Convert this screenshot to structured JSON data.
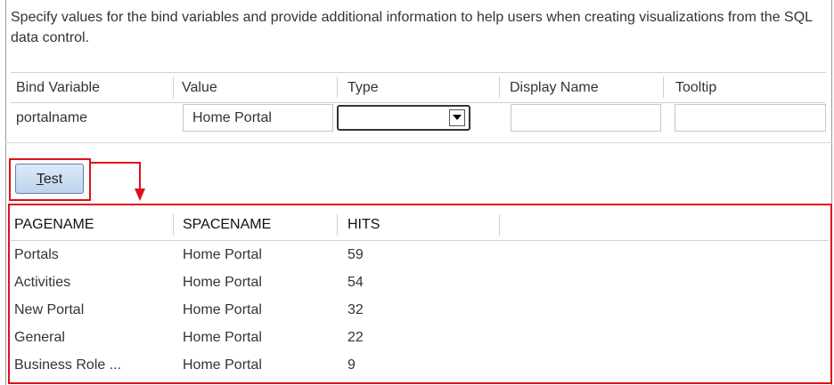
{
  "description": "Specify values for the bind variables and provide additional information to help users when creating visualizations from the SQL data control.",
  "bind_table": {
    "columns": [
      "Bind Variable",
      "Value",
      "Type",
      "Display Name",
      "Tooltip"
    ],
    "row": {
      "variable": "portalname",
      "value": "Home Portal",
      "type": "",
      "display_name": "",
      "tooltip": ""
    }
  },
  "test_button": {
    "mnemonic": "T",
    "rest": "est"
  },
  "results": {
    "columns": [
      "PAGENAME",
      "SPACENAME",
      "HITS"
    ],
    "rows": [
      {
        "pagename": "Portals",
        "spacename": "Home Portal",
        "hits": "59"
      },
      {
        "pagename": "Activities",
        "spacename": "Home Portal",
        "hits": "54"
      },
      {
        "pagename": "New Portal",
        "spacename": "Home Portal",
        "hits": "32"
      },
      {
        "pagename": "General",
        "spacename": "Home Portal",
        "hits": "22"
      },
      {
        "pagename": "Business Role ...",
        "spacename": "Home Portal",
        "hits": "9"
      }
    ]
  },
  "colors": {
    "highlight": "#e0101a",
    "button": "#cbdcf0"
  }
}
